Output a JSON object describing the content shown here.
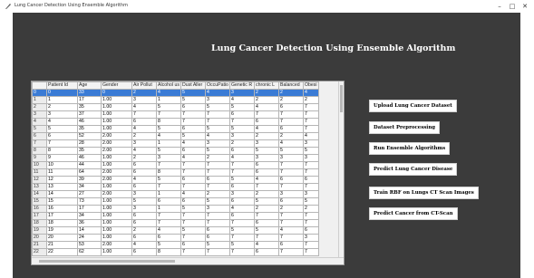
{
  "window": {
    "title": "Lung Cancer Detection Using Ensemble Algorithm",
    "minimize": "–",
    "maximize": "□",
    "close": "✕"
  },
  "main": {
    "heading": "Lung Cancer Detection Using Ensemble Algorithm"
  },
  "table": {
    "columns": [
      "",
      "Patient Id",
      "Age",
      "Gender",
      "Air Pollut",
      "Alcohol us",
      "Dust Aller",
      "OccuPatio",
      "Genetic R",
      "chronic L",
      "Balanced",
      "Obesi"
    ],
    "rows": [
      [
        "0",
        "0",
        "33",
        "0",
        "2",
        "4",
        "5",
        "4",
        "3",
        "2",
        "2",
        "4"
      ],
      [
        "1",
        "1",
        "17",
        "1.00",
        "3",
        "1",
        "5",
        "3",
        "4",
        "2",
        "2",
        "2"
      ],
      [
        "2",
        "2",
        "35",
        "1.00",
        "4",
        "5",
        "6",
        "5",
        "5",
        "4",
        "6",
        "7"
      ],
      [
        "3",
        "3",
        "37",
        "1.00",
        "7",
        "7",
        "7",
        "7",
        "6",
        "7",
        "7",
        "7"
      ],
      [
        "4",
        "4",
        "46",
        "1.00",
        "6",
        "8",
        "7",
        "7",
        "7",
        "6",
        "7",
        "7"
      ],
      [
        "5",
        "5",
        "35",
        "1.00",
        "4",
        "5",
        "6",
        "5",
        "5",
        "4",
        "6",
        "7"
      ],
      [
        "6",
        "6",
        "52",
        "2.00",
        "2",
        "4",
        "5",
        "4",
        "3",
        "2",
        "2",
        "4"
      ],
      [
        "7",
        "7",
        "28",
        "2.00",
        "3",
        "1",
        "4",
        "3",
        "2",
        "3",
        "4",
        "3"
      ],
      [
        "8",
        "8",
        "35",
        "2.00",
        "4",
        "5",
        "6",
        "5",
        "6",
        "5",
        "5",
        "5"
      ],
      [
        "9",
        "9",
        "46",
        "1.00",
        "2",
        "3",
        "4",
        "2",
        "4",
        "3",
        "3",
        "3"
      ],
      [
        "10",
        "10",
        "44",
        "1.00",
        "6",
        "7",
        "7",
        "7",
        "7",
        "6",
        "7",
        "7"
      ],
      [
        "11",
        "11",
        "64",
        "2.00",
        "6",
        "8",
        "7",
        "7",
        "7",
        "6",
        "7",
        "7"
      ],
      [
        "12",
        "12",
        "39",
        "2.00",
        "4",
        "5",
        "6",
        "6",
        "5",
        "4",
        "6",
        "6"
      ],
      [
        "13",
        "13",
        "34",
        "1.00",
        "6",
        "7",
        "7",
        "7",
        "6",
        "7",
        "7",
        "7"
      ],
      [
        "14",
        "14",
        "27",
        "2.00",
        "3",
        "1",
        "4",
        "2",
        "3",
        "2",
        "3",
        "3"
      ],
      [
        "15",
        "15",
        "73",
        "1.00",
        "5",
        "6",
        "6",
        "5",
        "6",
        "5",
        "6",
        "5"
      ],
      [
        "16",
        "16",
        "17",
        "1.00",
        "3",
        "1",
        "5",
        "3",
        "4",
        "2",
        "2",
        "2"
      ],
      [
        "17",
        "17",
        "34",
        "1.00",
        "6",
        "7",
        "7",
        "7",
        "6",
        "7",
        "7",
        "7"
      ],
      [
        "18",
        "18",
        "36",
        "1.00",
        "6",
        "7",
        "7",
        "7",
        "7",
        "6",
        "7",
        "7"
      ],
      [
        "19",
        "19",
        "14",
        "1.00",
        "2",
        "4",
        "5",
        "6",
        "5",
        "5",
        "4",
        "6"
      ],
      [
        "20",
        "20",
        "24",
        "1.00",
        "6",
        "6",
        "7",
        "6",
        "7",
        "7",
        "7",
        "3"
      ],
      [
        "21",
        "21",
        "53",
        "2.00",
        "4",
        "5",
        "6",
        "5",
        "5",
        "4",
        "6",
        "7"
      ],
      [
        "22",
        "22",
        "62",
        "1.00",
        "6",
        "8",
        "7",
        "7",
        "7",
        "6",
        "7",
        "7"
      ]
    ]
  },
  "buttons": {
    "upload": "Upload Lung Cancer Dataset",
    "preprocess": "Dataset Preprocessing",
    "ensemble": "Run Ensemble Algorithms",
    "predict_disease": "Predict Lung Cancer Disease",
    "train_rbf": "Train RBF on Lungs CT Scan Images",
    "predict_ct": "Predict Cancer from CT-Scan"
  }
}
